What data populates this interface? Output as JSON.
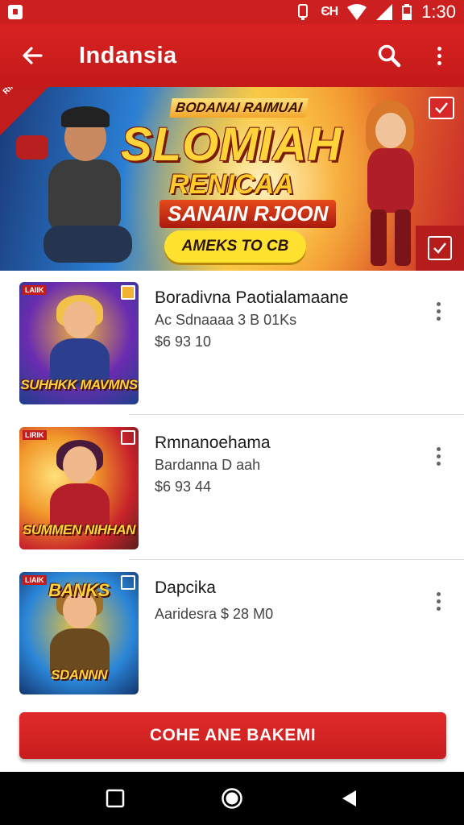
{
  "status_bar": {
    "signal_label": "ЄΗ",
    "time": "1:30"
  },
  "app_bar": {
    "title": "Indansia",
    "back_icon": "back-arrow-icon",
    "search_icon": "search-icon",
    "more_icon": "more-vert-icon",
    "background": "#d32020"
  },
  "banner": {
    "kicker": "BODANAI RAIMUAI",
    "title": "SLOMIAH",
    "subtitle": "RENICAA",
    "tagline": "SANAIN RJOON",
    "cta": "AMEKS TO CB",
    "corner_tag": "RIMIHE"
  },
  "items": [
    {
      "title": "Boradivna Paotialamaane",
      "subtitle": "Ac Sdnaaaa 3 B 01Ks",
      "price": "$6 93 10",
      "thumb_caption": "SUHHKK MAVMNS",
      "thumb_tag": "LAIIK",
      "thumb_colors": [
        "#6a2cb0",
        "#f0b23a",
        "#1f3f8a"
      ]
    },
    {
      "title": "Rmnanoehama",
      "subtitle": "Bardanna D aah",
      "price": "$6 93 44",
      "thumb_caption": "SUMMEN NIHHAN",
      "thumb_tag": "LIRIK",
      "thumb_colors": [
        "#f2992b",
        "#c8232a",
        "#5a1e1e"
      ]
    },
    {
      "title": "Dapcika",
      "subtitle": "Aaridesra $ 28 M0",
      "price": "",
      "thumb_caption": "SDANNN",
      "thumb_top": "BANKS",
      "thumb_tag": "LIAIK",
      "thumb_colors": [
        "#2a86d8",
        "#f2c33a",
        "#3a2a18"
      ]
    }
  ],
  "cta_button": {
    "label": "COHE ANE BAKEMI"
  },
  "nav_bar": {
    "recents_icon": "square-recents-icon",
    "home_icon": "circle-home-icon",
    "back_icon": "triangle-back-icon"
  }
}
